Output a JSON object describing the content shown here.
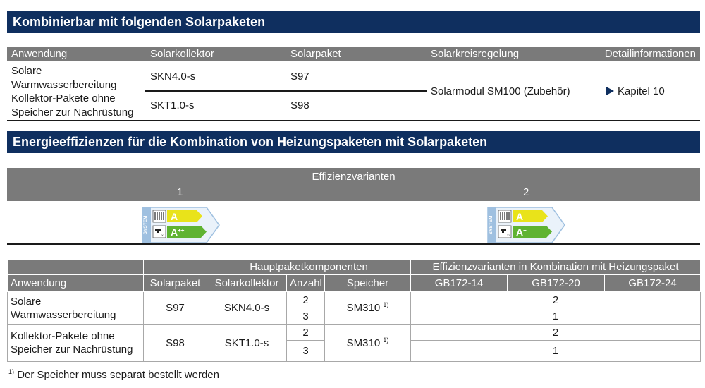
{
  "section1": {
    "title": "Kombinierbar mit folgenden Solarpaketen",
    "headers": [
      "Anwendung",
      "Solarkollektor",
      "Solarpaket",
      "Solarkreisregelung",
      "Detailinformationen"
    ],
    "row1_anwendung": "Solare Warmwasserbereitung",
    "row2_anwendung": "Kollektor-Pakete ohne Speicher zur Nachrüstung",
    "row1_kollektor": "SKN4.0-s",
    "row2_kollektor": "SKT1.0-s",
    "row1_paket": "S97",
    "row2_paket": "S98",
    "regelung": "Solarmodul SM100 (Zubehör)",
    "detail": "Kapitel 10"
  },
  "section2": {
    "title": "Energieeffizienzen für die Kombination von Heizungspaketen mit Solarpaketen",
    "variants_label": "Effizienzvarianten",
    "variant_numbers": [
      "1",
      "2"
    ],
    "labels": [
      {
        "system_text": "SYSTEM",
        "top_class": "A",
        "bottom_class": "A",
        "bottom_sup": "++",
        "top_color": "#e9e31a",
        "bottom_color": "#5fb331"
      },
      {
        "system_text": "SYSTEM",
        "top_class": "A",
        "bottom_class": "A",
        "bottom_sup": "+",
        "top_color": "#e9e31a",
        "bottom_color": "#5fb331"
      }
    ]
  },
  "table2": {
    "group_header_main": "Hauptpaketkomponenten",
    "group_header_eff": "Effizienzvarianten in Kombination mit Heizungspaket",
    "headers": {
      "anwendung": "Anwendung",
      "solarpaket": "Solarpaket",
      "solarkollektor": "Solarkollektor",
      "anzahl": "Anzahl",
      "speicher": "Speicher",
      "gb1": "GB172-14",
      "gb2": "GB172-20",
      "gb3": "GB172-24"
    },
    "rows": [
      {
        "anwendung": "Solare Warmwasserbereitung",
        "paket": "S97",
        "kollektor": "SKN4.0-s",
        "anzahl_a": "2",
        "anzahl_b": "3",
        "speicher": "SM310",
        "speicher_sup": "1)",
        "eff_a": "2",
        "eff_b": "1"
      },
      {
        "anwendung": "Kollektor-Pakete ohne Speicher zur Nachrüstung",
        "paket": "S98",
        "kollektor": "SKT1.0-s",
        "anzahl_a": "2",
        "anzahl_b": "3",
        "speicher": "SM310",
        "speicher_sup": "1)",
        "eff_a": "2",
        "eff_b": "1"
      }
    ]
  },
  "footnote": {
    "mark": "1)",
    "text": "Der Speicher muss separat bestellt werden"
  },
  "colors": {
    "navy": "#0f2f5f",
    "header_grey": "#7a7a7a",
    "label_border": "#9fc0e0"
  }
}
